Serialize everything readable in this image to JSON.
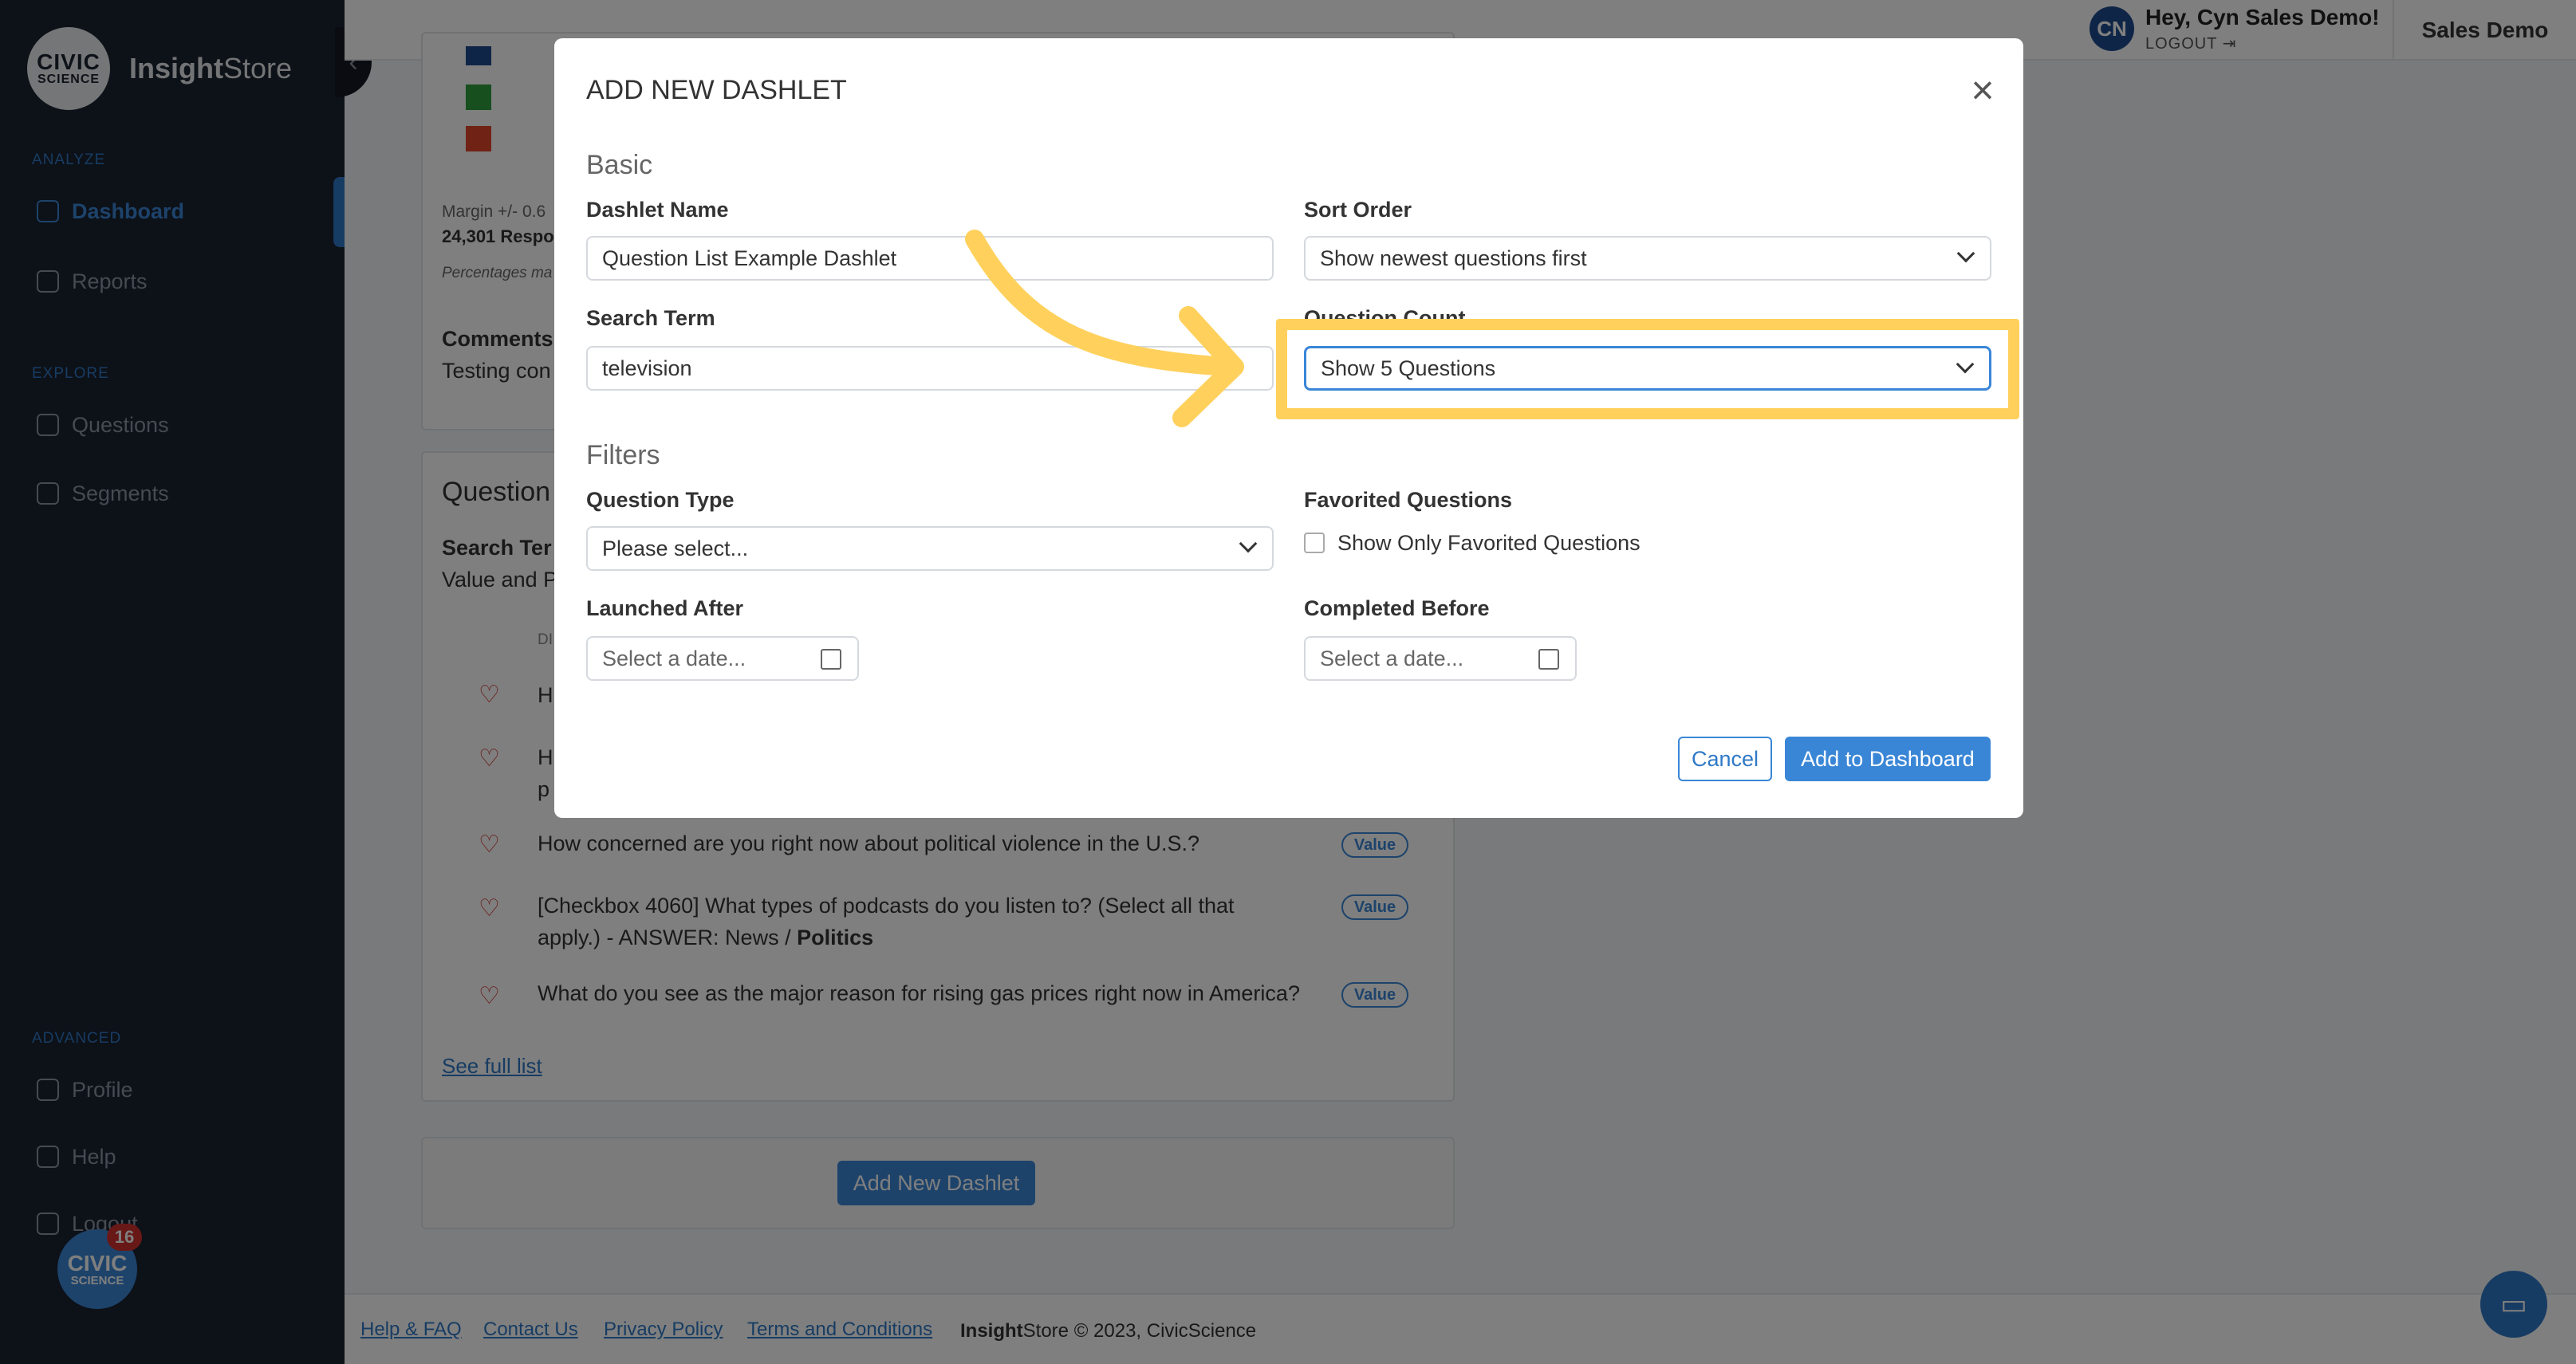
{
  "brand": {
    "logo_line1": "CIVIC",
    "logo_line2": "SCIENCE",
    "name_bold": "Insight",
    "name_rest": "Store"
  },
  "sidebar": {
    "sections": [
      "ANALYZE",
      "EXPLORE",
      "ADVANCED"
    ],
    "items": [
      {
        "label": "Dashboard",
        "icon": "dashboard-icon",
        "active": true
      },
      {
        "label": "Reports",
        "icon": "document-icon"
      },
      {
        "label": "Questions",
        "icon": "question-icon"
      },
      {
        "label": "Segments",
        "icon": "segments-icon"
      },
      {
        "label": "Profile",
        "icon": "profile-icon"
      },
      {
        "label": "Help",
        "icon": "help-icon"
      },
      {
        "label": "Logout",
        "icon": "logout-icon"
      }
    ],
    "badge_line1": "CIVIC",
    "badge_line2": "SCIENCE",
    "notification_count": "16"
  },
  "topbar": {
    "avatar_initials": "CN",
    "greeting": "Hey, Cyn Sales Demo!",
    "logout": "LOGOUT",
    "org": "Sales Demo"
  },
  "background": {
    "margin_text": "Margin +/- 0.6",
    "responses_text": "24,301 Respo",
    "percent_note": "Percentages ma",
    "comments_label": "Comments",
    "comments_value": "Testing con",
    "card_title": "Question",
    "search_label": "Search Ter",
    "search_sub": "Value and P",
    "col_hdr": "DI",
    "questions": [
      {
        "text": "H",
        "badge": ""
      },
      {
        "text": "H",
        "text2": "p",
        "badge": ""
      },
      {
        "text": "How concerned are you right now about political violence in the U.S.?",
        "badge": "Value"
      },
      {
        "text": "[Checkbox 4060] What types of podcasts do you listen to? (Select all that",
        "text2": "apply.) - ANSWER: News / ",
        "bold": "Politics",
        "badge": "Value"
      },
      {
        "text": "What do you see as the major reason for rising gas prices right now in America?",
        "badge": "Value"
      }
    ],
    "see_full_list": "See full list",
    "add_new_dashlet": "Add New Dashlet"
  },
  "footer": {
    "links": [
      "Help & FAQ",
      "Contact Us",
      "Privacy Policy",
      "Terms and Conditions"
    ],
    "copyright_bold": "Insight",
    "copyright_rest": "Store © 2023, CivicScience"
  },
  "modal": {
    "title": "ADD NEW DASHLET",
    "basic_heading": "Basic",
    "filters_heading": "Filters",
    "dashlet_name_label": "Dashlet Name",
    "dashlet_name_value": "Question List Example Dashlet",
    "sort_order_label": "Sort Order",
    "sort_order_value": "Show newest questions first",
    "search_term_label": "Search Term",
    "search_term_value": "television",
    "question_count_label": "Question Count",
    "question_count_value": "Show 5 Questions",
    "question_type_label": "Question Type",
    "question_type_value": "Please select...",
    "favorited_label": "Favorited Questions",
    "favorited_checkbox": "Show Only Favorited Questions",
    "launched_after_label": "Launched After",
    "launched_after_placeholder": "Select a date...",
    "completed_before_label": "Completed Before",
    "completed_before_placeholder": "Select a date...",
    "cancel": "Cancel",
    "add": "Add to Dashboard"
  },
  "annotation": {
    "highlight_color": "#ffd15c"
  }
}
